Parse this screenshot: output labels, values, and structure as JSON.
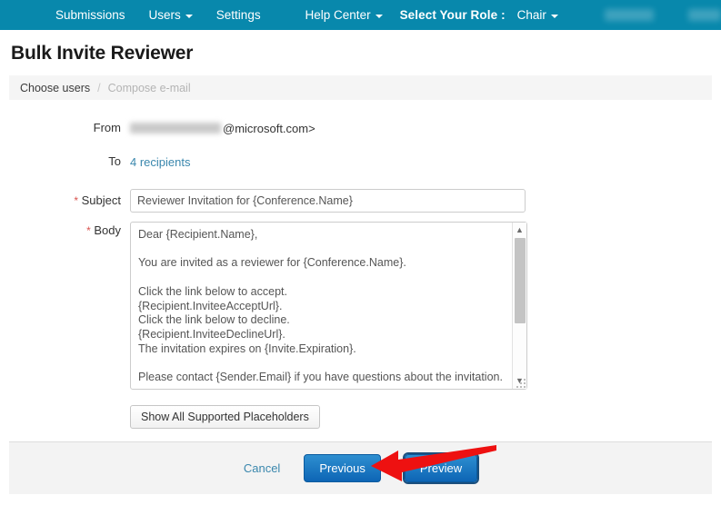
{
  "navbar": {
    "items": [
      {
        "label": "Submissions",
        "caret": false
      },
      {
        "label": "Users",
        "caret": true
      },
      {
        "label": "Settings",
        "caret": false
      },
      {
        "label": "Help Center",
        "caret": true
      }
    ],
    "role_label": "Select Your Role :",
    "role_value": "Chair",
    "brand_color": "#0888ac",
    "redacted_items": [
      "",
      ""
    ]
  },
  "page": {
    "title": "Bulk Invite Reviewer"
  },
  "breadcrumb": {
    "active": "Choose users",
    "separator": "/",
    "inactive": "Compose e-mail"
  },
  "form": {
    "from": {
      "label": "From",
      "redacted_name": "",
      "domain": "@microsoft.com>"
    },
    "to": {
      "label": "To",
      "value": "4 recipients"
    },
    "subject": {
      "label": "Subject",
      "required_marker": "*",
      "value": "Reviewer Invitation for {Conference.Name}",
      "placeholder": ""
    },
    "body": {
      "label": "Body",
      "required_marker": "*",
      "value": "Dear {Recipient.Name},\n\nYou are invited as a reviewer for {Conference.Name}.\n\nClick the link below to accept.\n{Recipient.InviteeAcceptUrl}.\nClick the link below to decline.\n{Recipient.InviteeDeclineUrl}.\nThe invitation expires on {Invite.Expiration}.\n\nPlease contact {Sender.Email} if you have questions about the invitation.",
      "placeholder": ""
    },
    "placeholders_button": "Show All Supported Placeholders"
  },
  "footer": {
    "cancel_label": "Cancel",
    "previous_label": "Previous",
    "preview_label": "Preview"
  },
  "annotation": {
    "arrow_color": "#ee1111",
    "points_to": "Preview"
  }
}
